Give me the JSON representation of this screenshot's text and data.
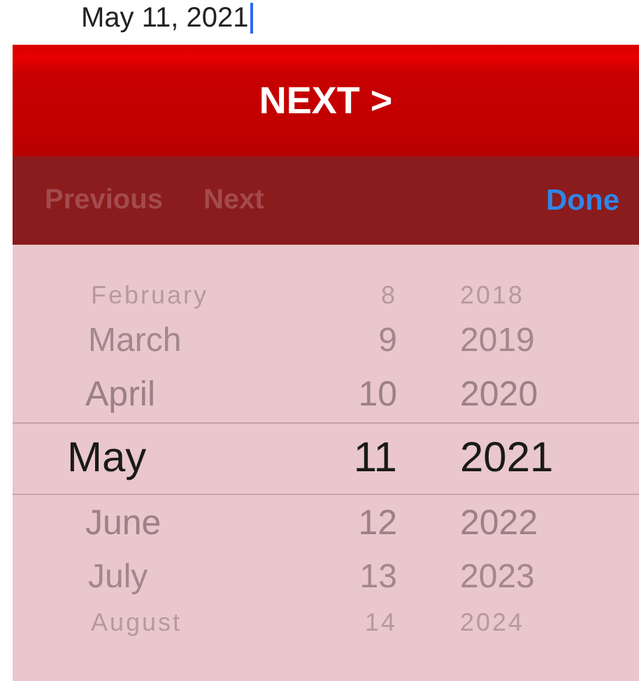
{
  "date_field": {
    "value": "May 11, 2021"
  },
  "next_button": {
    "label": "NEXT >"
  },
  "toolbar": {
    "buttons": [
      {
        "label": "Previous",
        "disabled": true
      },
      {
        "label": "Next",
        "disabled": true
      }
    ],
    "done": {
      "label": "Done"
    }
  },
  "picker": {
    "rows": [
      {
        "month": "February",
        "day": "8",
        "year": "2018",
        "selected": false
      },
      {
        "month": "March",
        "day": "9",
        "year": "2019",
        "selected": false
      },
      {
        "month": "April",
        "day": "10",
        "year": "2020",
        "selected": false
      },
      {
        "month": "May",
        "day": "11",
        "year": "2021",
        "selected": true
      },
      {
        "month": "June",
        "day": "12",
        "year": "2022",
        "selected": false
      },
      {
        "month": "July",
        "day": "13",
        "year": "2023",
        "selected": false
      },
      {
        "month": "August",
        "day": "14",
        "year": "2024",
        "selected": false
      }
    ]
  }
}
